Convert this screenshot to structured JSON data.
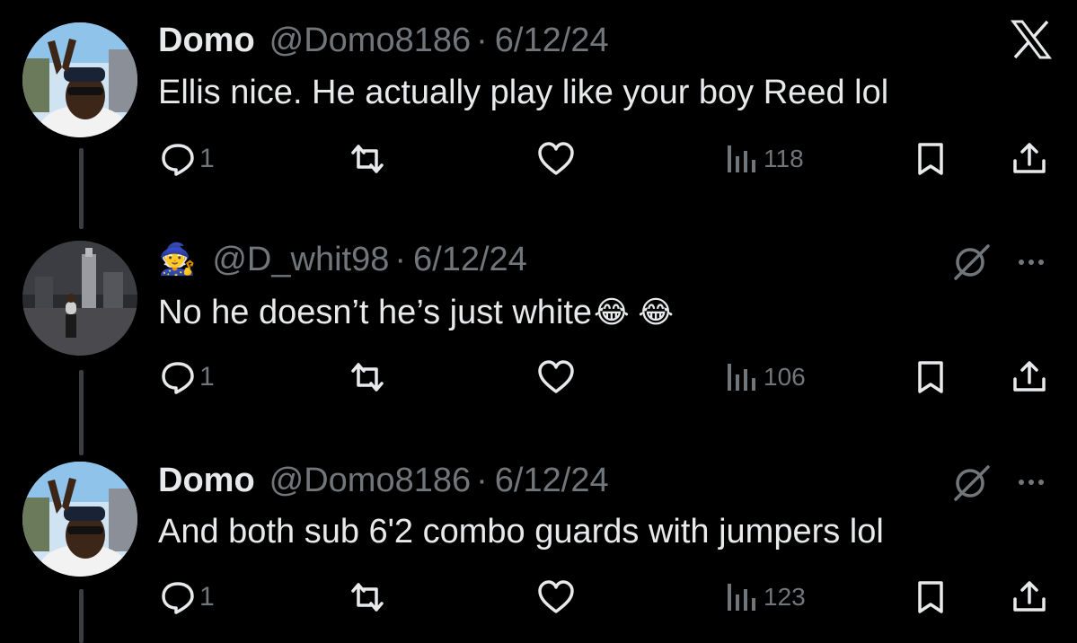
{
  "tweets": [
    {
      "name": "Domo",
      "handle": "@Domo8186",
      "date": "6/12/24",
      "text": "Ellis nice. He actually play like your boy Reed lol",
      "replies": "1",
      "views": "118",
      "top_right_icon": "x-logo-icon"
    },
    {
      "name": "",
      "handle": "@D_whit98",
      "date": "6/12/24",
      "text": "No he doesn’t he’s just white",
      "text_emojis": "😂 😂",
      "name_emoji": "wizard-emoji",
      "replies": "1",
      "views": "106",
      "top_right_icon": "grok-icon"
    },
    {
      "name": "Domo",
      "handle": "@Domo8186",
      "date": "6/12/24",
      "text": "And both sub 6'2 combo guards with jumpers lol",
      "replies": "1",
      "views": "123",
      "top_right_icon": "grok-icon"
    }
  ],
  "separator": "·",
  "colors": {
    "background": "#000000",
    "text": "#e7e9ea",
    "muted": "#71767b",
    "thread_line": "#3a3d41"
  }
}
